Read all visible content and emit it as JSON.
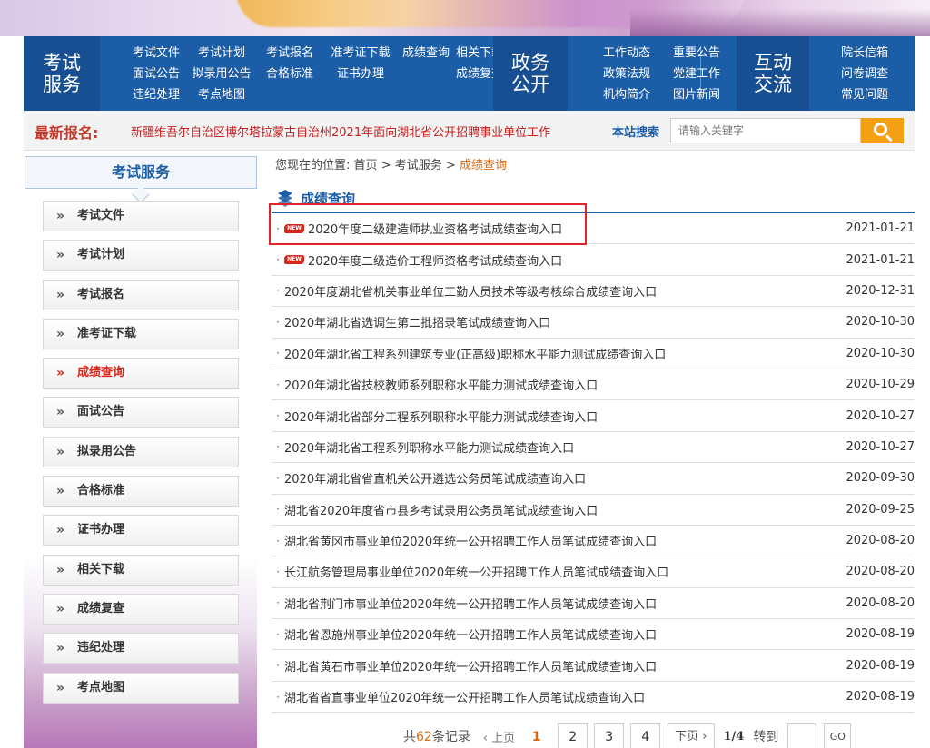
{
  "nav": {
    "group1_title": "考试服务",
    "group1_links": [
      "考试文件",
      "考试计划",
      "考试报名",
      "准考证下载",
      "成绩查询",
      "相关下载",
      "面试公告",
      "拟录用公告",
      "合格标准",
      "证书办理",
      "",
      "成绩复查",
      "违纪处理",
      "考点地图"
    ],
    "group2_title": "政务公开",
    "group2_links": [
      "工作动态",
      "重要公告",
      "政策法规",
      "党建工作",
      "机构简介",
      "图片新闻"
    ],
    "group3_title": "互动交流",
    "group3_links": [
      "院长信箱",
      "问卷调查",
      "常见问题"
    ]
  },
  "notice": {
    "label": "最新报名:",
    "message": "新疆维吾尔自治区博尔塔拉蒙古自治州2021年面向湖北省公开招聘事业单位工作",
    "search_label": "本站搜索",
    "search_placeholder": "请输入关键字"
  },
  "sidebar": {
    "title": "考试服务",
    "items": [
      "考试文件",
      "考试计划",
      "考试报名",
      "准考证下载",
      "成绩查询",
      "面试公告",
      "拟录用公告",
      "合格标准",
      "证书办理",
      "相关下载",
      "成绩复查",
      "违纪处理",
      "考点地图"
    ],
    "active": "成绩查询"
  },
  "breadcrumb": {
    "prefix": "您现在的位置:",
    "home": "首页",
    "section": "考试服务",
    "current": "成绩查询",
    "sep": ">"
  },
  "section_title": "成绩查询",
  "new_badge": "NEW",
  "list": [
    {
      "title": "2020年度二级建造师执业资格考试成绩查询入口",
      "date": "2021-01-21",
      "new": true
    },
    {
      "title": "2020年度二级造价工程师资格考试成绩查询入口",
      "date": "2021-01-21",
      "new": true
    },
    {
      "title": "2020年度湖北省机关事业单位工勤人员技术等级考核综合成绩查询入口",
      "date": "2020-12-31",
      "new": false
    },
    {
      "title": "2020年湖北省选调生第二批招录笔试成绩查询入口",
      "date": "2020-10-30",
      "new": false
    },
    {
      "title": "2020年湖北省工程系列建筑专业(正高级)职称水平能力测试成绩查询入口",
      "date": "2020-10-30",
      "new": false
    },
    {
      "title": "2020年湖北省技校教师系列职称水平能力测试成绩查询入口",
      "date": "2020-10-29",
      "new": false
    },
    {
      "title": "2020年湖北省部分工程系列职称水平能力测试成绩查询入口",
      "date": "2020-10-27",
      "new": false
    },
    {
      "title": "2020年湖北省工程系列职称水平能力测试成绩查询入口",
      "date": "2020-10-27",
      "new": false
    },
    {
      "title": "2020年湖北省省直机关公开遴选公务员笔试成绩查询入口",
      "date": "2020-09-30",
      "new": false
    },
    {
      "title": "湖北省2020年度省市县乡考试录用公务员笔试成绩查询入口",
      "date": "2020-09-25",
      "new": false
    },
    {
      "title": "湖北省黄冈市事业单位2020年统一公开招聘工作人员笔试成绩查询入口",
      "date": "2020-08-20",
      "new": false
    },
    {
      "title": "长江航务管理局事业单位2020年统一公开招聘工作人员笔试成绩查询入口",
      "date": "2020-08-20",
      "new": false
    },
    {
      "title": "湖北省荆门市事业单位2020年统一公开招聘工作人员笔试成绩查询入口",
      "date": "2020-08-20",
      "new": false
    },
    {
      "title": "湖北省恩施州事业单位2020年统一公开招聘工作人员笔试成绩查询入口",
      "date": "2020-08-19",
      "new": false
    },
    {
      "title": "湖北省黄石市事业单位2020年统一公开招聘工作人员笔试成绩查询入口",
      "date": "2020-08-19",
      "new": false
    },
    {
      "title": "湖北省省直事业单位2020年统一公开招聘工作人员笔试成绩查询入口",
      "date": "2020-08-19",
      "new": false
    }
  ],
  "pager": {
    "total_prefix": "共",
    "total": "62",
    "total_suffix": "条记录",
    "prev": "‹ 上页",
    "pages": [
      "1",
      "2",
      "3",
      "4"
    ],
    "current": "1",
    "next": "下页 ›",
    "page_info": "1/4",
    "goto": "转到",
    "go": "GO"
  },
  "colors": {
    "primary": "#1c5da8",
    "accent": "#e06a10",
    "highlight": "#e0262a",
    "search_button": "#f5a012"
  }
}
